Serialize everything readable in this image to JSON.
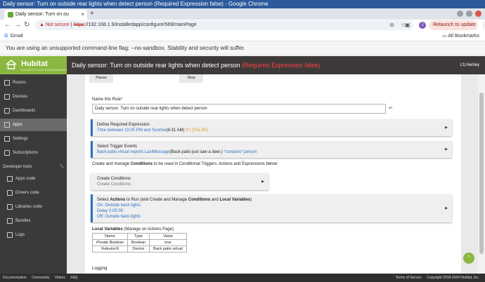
{
  "window": {
    "title": "Daily sensor: Turn on outside rear lights when detect person (Required Expression false) - Google Chrome"
  },
  "browser": {
    "tab_title": "Daily sensor: Turn on ou",
    "tab_close": "×",
    "new_tab": "+",
    "security_label": "Not secure",
    "url_scheme": "https",
    "url_rest": "://192.168.1.9/installedapp/configure/569/mainPage",
    "avatar_letter": "J",
    "relaunch_label": "Relaunch to update",
    "bookmark_gmail": "Gmail",
    "bookmark_all": "All Bookmarks",
    "info_message": "You are using an unsupported command-line flag: --no-sandbox. Stability and security will suffer."
  },
  "app": {
    "brand": "Hubitat",
    "tagline": "ELEVATE YOUR ENVIRONMENT",
    "title_main": "Daily sensor: Turn on outside rear lights when detect person",
    "title_status": "(Required Expression false)",
    "user": "LS,Henley"
  },
  "sidebar": {
    "items": [
      {
        "label": "Rooms"
      },
      {
        "label": "Devices"
      },
      {
        "label": "Dashboards"
      },
      {
        "label": "Apps"
      },
      {
        "label": "Settings"
      },
      {
        "label": "Subscriptions"
      }
    ],
    "dev_tools_header": "Developer tools",
    "dev_items": [
      {
        "label": "Apps code"
      },
      {
        "label": "Drivers code"
      },
      {
        "label": "Libraries code"
      },
      {
        "label": "Bundles"
      },
      {
        "label": "Logs"
      }
    ],
    "footer": [
      "Documentation",
      "Community",
      "Videos",
      "FAQ"
    ]
  },
  "main": {
    "pause_label": "Pause",
    "stop_label": "Stop",
    "name_label": "Name this Rule*",
    "name_value": "Daily sensor:  Turn on outside rear lights when detect person",
    "required_expression": {
      "title": "Define Required Expression",
      "detail": "Time between 10:05 PM and Sunrise",
      "time": "(6:31 AM)",
      "flag": "(F)",
      "result": "[FALSE]"
    },
    "trigger": {
      "title": "Select Trigger Events",
      "detail_pre": "Back patio virtual reports LastMessage",
      "detail_mid": "(Back patio just saw a deer.)",
      "detail_post": " *contains* person"
    },
    "conditions_text_pre": "Create and manage ",
    "conditions_text_bold": "Conditions",
    "conditions_text_post": " to be used in Conditional Triggers, Actions and Expressions below:",
    "create_conditions": {
      "title": "Create Conditions",
      "subtitle": "Create Conditions"
    },
    "actions": {
      "t1": "Select ",
      "t2": "Actions",
      "t3": " to Run (and Create and Manage ",
      "t4": "Conditions",
      "t5": " and ",
      "t6": "Local Variables",
      "t7": ")",
      "lines": [
        "On: Outside back lights",
        "Delay 0:05:00",
        "Off: Outside back lights"
      ]
    },
    "local_vars_title": "Local Variables",
    "local_vars_note": " (Manage on Actions Page)",
    "table": {
      "headers": [
        "Name",
        "Type",
        "Value"
      ],
      "rows": [
        [
          "Private Boolean",
          "Boolean",
          "true"
        ],
        [
          "%device%",
          "Device",
          "Back patio virtual"
        ]
      ]
    },
    "logging_label": "Logging"
  },
  "footer": {
    "terms": "Terms of Service",
    "copyright": "Copyright 2018-2024 Hubitat, Inc."
  },
  "colors": {
    "brand_green": "#8ab73f",
    "accent_blue": "#2e6fc7",
    "status_red": "#ff4040",
    "header_dark": "#3e3a3a"
  }
}
